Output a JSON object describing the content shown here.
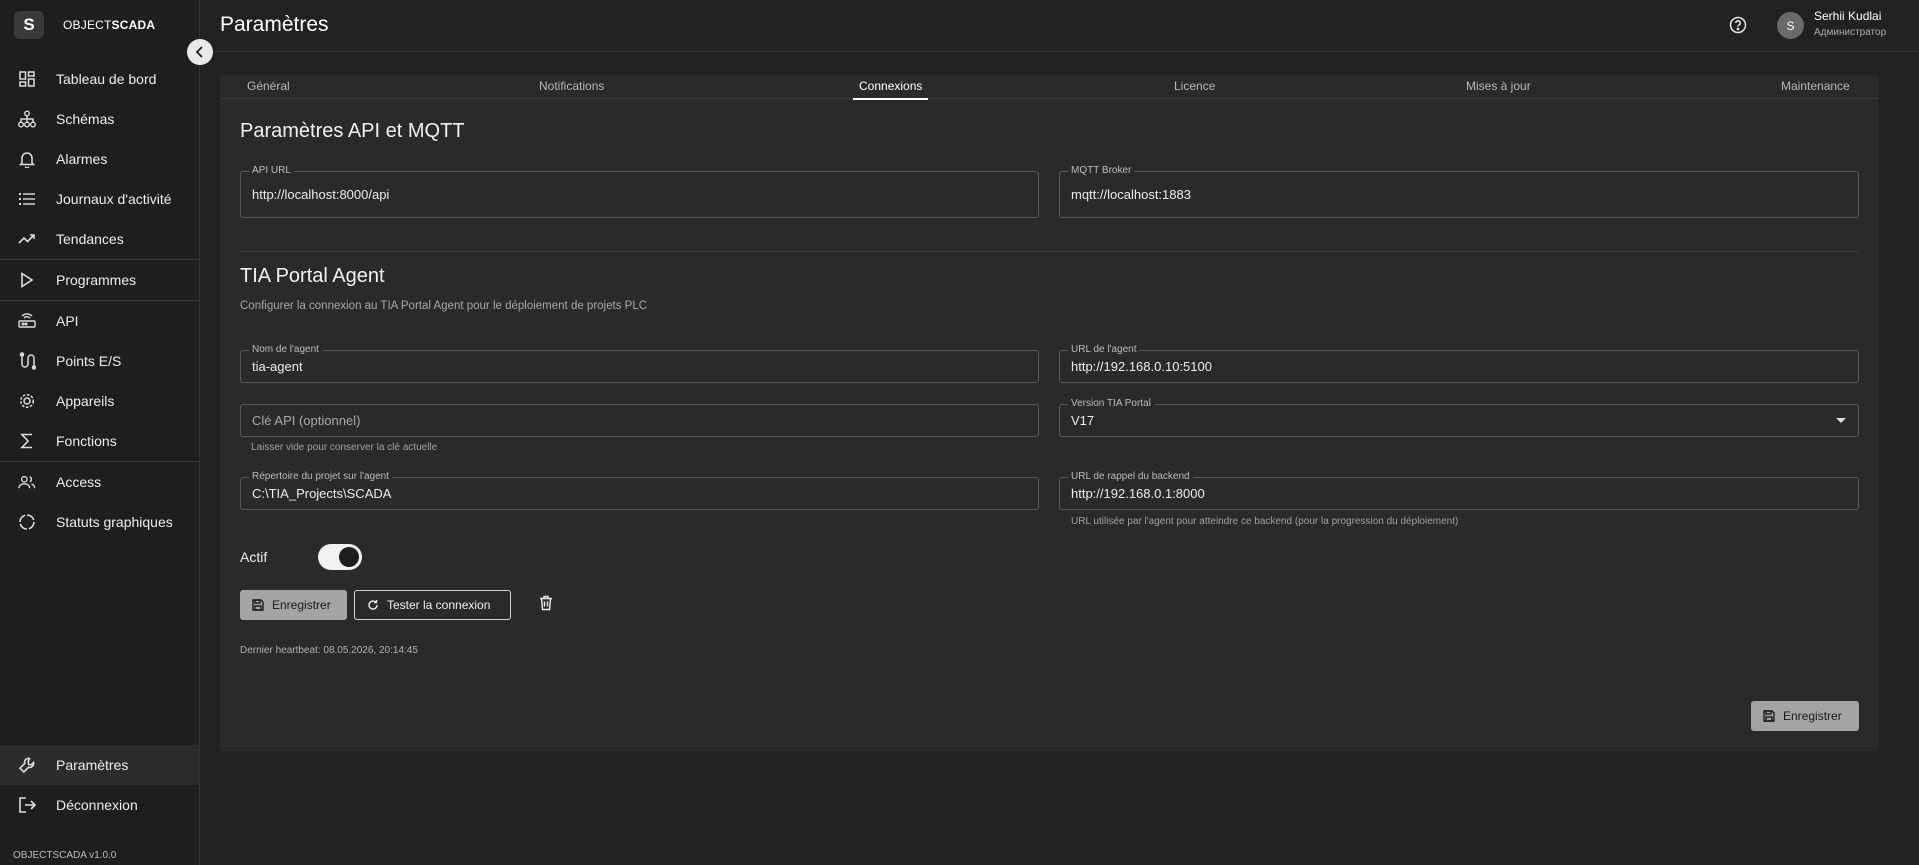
{
  "brand": {
    "logo_letter": "S",
    "name_light": "OBJECT",
    "name_bold": "SCADA"
  },
  "sidebar": {
    "items": [
      {
        "label": "Tableau de bord",
        "icon": "dashboard-icon"
      },
      {
        "label": "Schémas",
        "icon": "hierarchy-icon"
      },
      {
        "label": "Alarmes",
        "icon": "bell-icon"
      },
      {
        "label": "Journaux d'activité",
        "icon": "list-icon"
      },
      {
        "label": "Tendances",
        "icon": "trending-up-icon"
      },
      {
        "label": "Programmes",
        "icon": "play-icon"
      },
      {
        "label": "API",
        "icon": "router-icon"
      },
      {
        "label": "Points E/S",
        "icon": "io-points-icon"
      },
      {
        "label": "Appareils",
        "icon": "gear-icon"
      },
      {
        "label": "Fonctions",
        "icon": "sigma-icon"
      },
      {
        "label": "Access",
        "icon": "users-icon"
      },
      {
        "label": "Statuts graphiques",
        "icon": "circle-status-icon"
      }
    ],
    "bottom": [
      {
        "label": "Paramètres",
        "icon": "wrench-icon"
      },
      {
        "label": "Déconnexion",
        "icon": "logout-icon"
      }
    ],
    "version": "OBJECTSCADA v1.0.0"
  },
  "header": {
    "title": "Paramètres",
    "user": {
      "initial": "S",
      "name": "Serhii Kudlai",
      "role": "Администратор"
    }
  },
  "tabs": [
    "Général",
    "Notifications",
    "Connexions",
    "Licence",
    "Mises à jour",
    "Maintenance"
  ],
  "api_section": {
    "title": "Paramètres API et MQTT",
    "api_url": {
      "label": "API URL",
      "value": "http://localhost:8000/api"
    },
    "mqtt": {
      "label": "MQTT Broker",
      "value": "mqtt://localhost:1883"
    }
  },
  "tia": {
    "title": "TIA Portal Agent",
    "subtitle": "Configurer la connexion au TIA Portal Agent pour le déploiement de projets PLC",
    "agent_name": {
      "label": "Nom de l'agent",
      "value": "tia-agent"
    },
    "agent_url": {
      "label": "URL de l'agent",
      "value": "http://192.168.0.10:5100"
    },
    "api_key": {
      "placeholder": "Clé API (optionnel)",
      "helper": "Laisser vide pour conserver la clé actuelle"
    },
    "tia_version": {
      "label": "Version TIA Portal",
      "value": "V17"
    },
    "project_dir": {
      "label": "Répertoire du projet sur l'agent",
      "value": "C:\\TIA_Projects\\SCADA"
    },
    "callback_url": {
      "label": "URL de rappel du backend",
      "value": "http://192.168.0.1:8000",
      "helper": "URL utilisée par l'agent pour atteindre ce backend (pour la progression du déploiement)"
    },
    "active_label": "Actif",
    "active": true,
    "save_label": "Enregistrer",
    "test_label": "Tester la connexion",
    "heartbeat": "Dernier heartbeat: 08.05.2026, 20:14:45"
  },
  "footer_save_label": "Enregistrer"
}
